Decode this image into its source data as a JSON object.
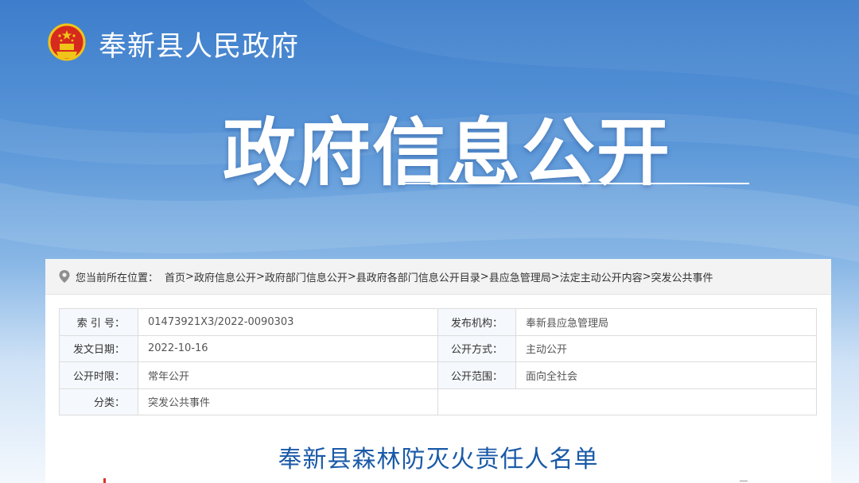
{
  "header": {
    "site_title": "奉新县人民政府"
  },
  "hero": {
    "title": "政府信息公开"
  },
  "breadcrumb": {
    "label": "您当前所在位置：",
    "items": [
      "首页",
      "政府信息公开",
      "政府部门信息公开",
      "县政府各部门信息公开目录",
      "县应急管理局",
      "法定主动公开内容",
      "突发公共事件"
    ],
    "separator": ">"
  },
  "meta": {
    "rows": [
      {
        "k1": "索 引 号：",
        "v1": "01473921X3/2022-0090303",
        "k2": "发布机构：",
        "v2": "奉新县应急管理局"
      },
      {
        "k1": "发文日期：",
        "v1": "2022-10-16",
        "k2": "公开方式：",
        "v2": "主动公开"
      },
      {
        "k1": "公开时限：",
        "v1": "常年公开",
        "k2": "公开范围：",
        "v2": "面向全社会"
      },
      {
        "k1": "分类：",
        "v1": "突发公共事件",
        "k2": "",
        "v2": ""
      }
    ]
  },
  "article": {
    "title": "奉新县森林防灭火责任人名单"
  },
  "icons": {
    "emblem": "national-emblem-icon",
    "location": "location-pin-icon"
  },
  "colors": {
    "banner_top": "#3d7dcb",
    "article_title": "#1a5aa8",
    "label_bg": "#f5f8fc"
  }
}
